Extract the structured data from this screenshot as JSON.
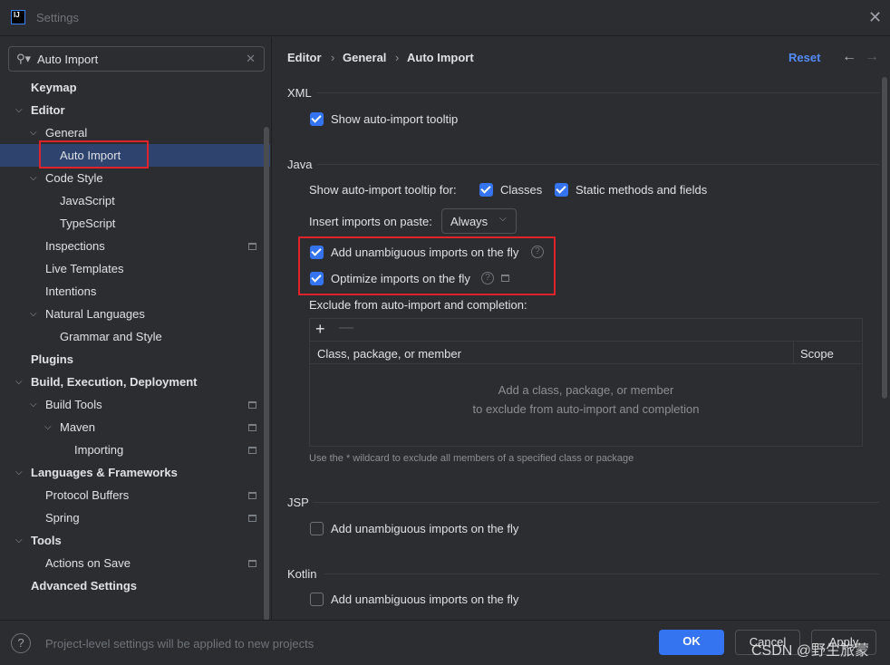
{
  "window": {
    "title": "Settings",
    "logo": "IJ"
  },
  "search": {
    "value": "Auto Import"
  },
  "tree": [
    {
      "label": "Keymap",
      "level": 0,
      "bold": true,
      "chevron": false
    },
    {
      "label": "Editor",
      "level": 0,
      "bold": true,
      "chevron": true
    },
    {
      "label": "General",
      "level": 1,
      "chevron": true
    },
    {
      "label": "Auto Import",
      "level": 2,
      "selected": true
    },
    {
      "label": "Code Style",
      "level": 1,
      "chevron": true
    },
    {
      "label": "JavaScript",
      "level": 2
    },
    {
      "label": "TypeScript",
      "level": 2
    },
    {
      "label": "Inspections",
      "level": 1,
      "project": true
    },
    {
      "label": "Live Templates",
      "level": 1
    },
    {
      "label": "Intentions",
      "level": 1
    },
    {
      "label": "Natural Languages",
      "level": 1,
      "chevron": true
    },
    {
      "label": "Grammar and Style",
      "level": 2
    },
    {
      "label": "Plugins",
      "level": 0,
      "bold": true
    },
    {
      "label": "Build, Execution, Deployment",
      "level": 0,
      "bold": true,
      "chevron": true
    },
    {
      "label": "Build Tools",
      "level": 1,
      "chevron": true,
      "project": true
    },
    {
      "label": "Maven",
      "level": 2,
      "chevron": true,
      "project": true
    },
    {
      "label": "Importing",
      "level": 3,
      "project": true
    },
    {
      "label": "Languages & Frameworks",
      "level": 0,
      "bold": true,
      "chevron": true
    },
    {
      "label": "Protocol Buffers",
      "level": 1,
      "project": true
    },
    {
      "label": "Spring",
      "level": 1,
      "project": true
    },
    {
      "label": "Tools",
      "level": 0,
      "bold": true,
      "chevron": true
    },
    {
      "label": "Actions on Save",
      "level": 1,
      "project": true
    },
    {
      "label": "Advanced Settings",
      "level": 0,
      "bold": true
    }
  ],
  "breadcrumb": [
    "Editor",
    "General",
    "Auto Import"
  ],
  "reset": "Reset",
  "xml": {
    "title": "XML",
    "show_tooltip": "Show auto-import tooltip"
  },
  "java": {
    "title": "Java",
    "tooltip_for": "Show auto-import tooltip for:",
    "classes": "Classes",
    "static": "Static methods and fields",
    "insert_label": "Insert imports on paste:",
    "insert_value": "Always",
    "add_unambiguous": "Add unambiguous imports on the fly",
    "optimize": "Optimize imports on the fly",
    "exclude_label": "Exclude from auto-import and completion:",
    "col_class": "Class, package, or member",
    "col_scope": "Scope",
    "empty1": "Add a class, package, or member",
    "empty2": "to exclude from auto-import and completion",
    "hint": "Use the * wildcard to exclude all members of a specified class or package"
  },
  "jsp": {
    "title": "JSP",
    "add_unambiguous": "Add unambiguous imports on the fly"
  },
  "kotlin": {
    "title": "Kotlin",
    "add_unambiguous": "Add unambiguous imports on the fly"
  },
  "footer": {
    "note": "Project-level settings will be applied to new projects",
    "ok": "OK",
    "cancel": "Cancel",
    "apply": "Apply",
    "watermark": "CSDN @野生旅蒙"
  },
  "colors": {
    "accent": "#3574f0",
    "highlight": "#e0232b",
    "selection": "#2e436e"
  }
}
